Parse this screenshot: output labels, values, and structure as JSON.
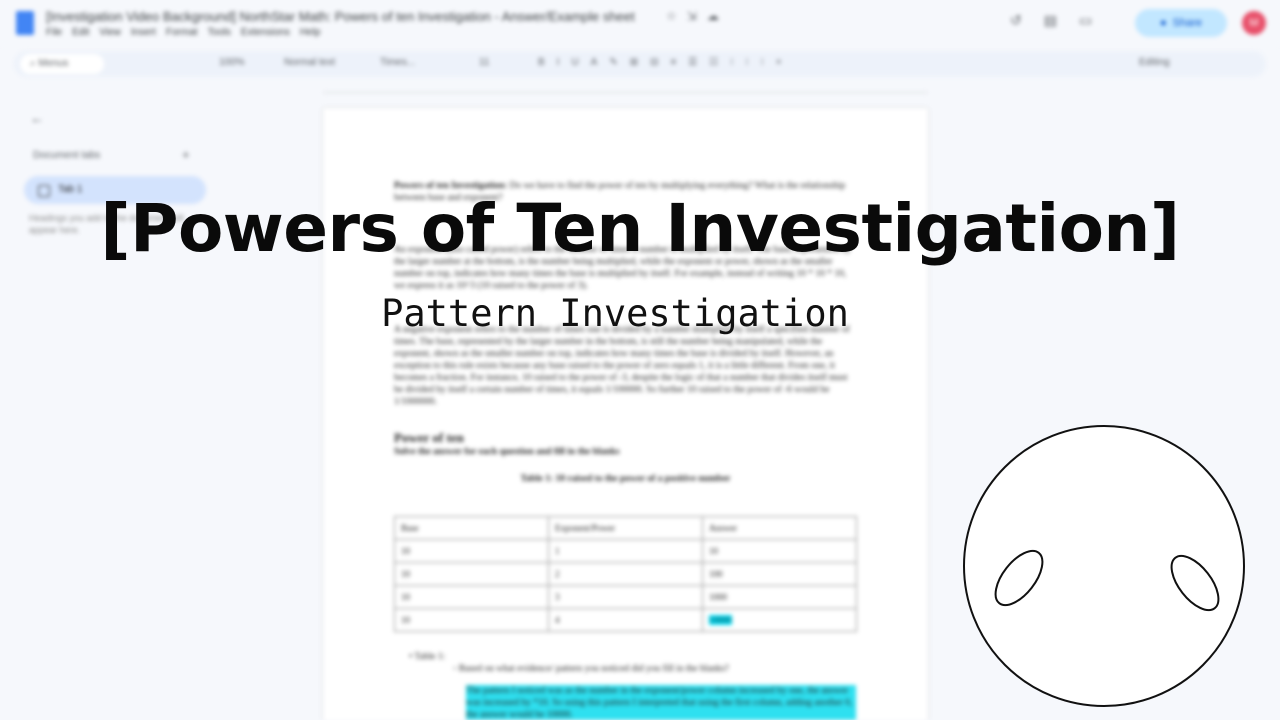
{
  "doc": {
    "title": "[Investigation Video Background] NorthStar Math: Powers of ten Investigation - Answer/Example sheet",
    "menu": [
      "File",
      "Edit",
      "View",
      "Insert",
      "Format",
      "Tools",
      "Extensions",
      "Help"
    ],
    "share_label": "Share",
    "avatar_initial": "M",
    "search_placeholder": "Menus",
    "zoom": "100%",
    "style": "Normal text",
    "font": "Times...",
    "font_size": "11",
    "mode": "Editing"
  },
  "sidebar": {
    "tabs_title": "Document tabs",
    "tab_label": "Tab 1",
    "note": "Headings you add to the document will appear here."
  },
  "page": {
    "intro_bold": "Powers of ten Investigation:",
    "intro": "Do we have to find the power of ten by multiplying everything? What is the relationship between base and exponent?",
    "para1": "An exponent (also called power) refers to the number of times a number is multiplied by itself. The base, represented by the larger number at the bottom, is the number being multiplied, while the exponent or power, shown as the smaller number on top, indicates how many times the base is multiplied by itself. For example, instead of writing 10 * 10 * 10, we express it as 10^3 (10 raised to the power of 3).",
    "para2": "A negative exponent refers to the number of times one is divided by a number multiplied by itself a specified number of times. The base, represented by the larger number in the bottom, is still the number being manipulated, while the exponent, shown as the smaller number on top, indicates how many times the base is divided by itself. However, an exception to this rule exists because any base raised to the power of zero equals 1, it is a little different. From one, it becomes a fraction. For instance, 10 raised to the power of -3, despite the logic of that a number that divides itself must be divided by itself a certain number of times, it equals 1/100000. So further 10 raised to the power of -6 would be 1/1000000.",
    "heading": "Power of ten",
    "instruction": "Solve the answer for each question and fill in the blanks",
    "table_caption": "Table 1: 10 raised to the power of a positive number",
    "table": {
      "headers": [
        "Base",
        "Exponent/Power",
        "Answer"
      ],
      "rows": [
        [
          "10",
          "1",
          "10"
        ],
        [
          "10",
          "2",
          "100"
        ],
        [
          "10",
          "3",
          "1000"
        ],
        [
          "10",
          "4",
          "10000"
        ]
      ]
    },
    "bullet": "Table 1:",
    "question": "Based on what evidence/ pattern you noticed did you fill in the blanks?",
    "answer": "The pattern I noticed was as the number in the exponent/power column increased by one, the answer was increased by *10. So using this pattern I interpreted that using the first column, adding another 0, the answer would be 10000."
  },
  "overlay": {
    "title": "[Powers of Ten Investigation]",
    "subtitle": "Pattern Investigation"
  }
}
